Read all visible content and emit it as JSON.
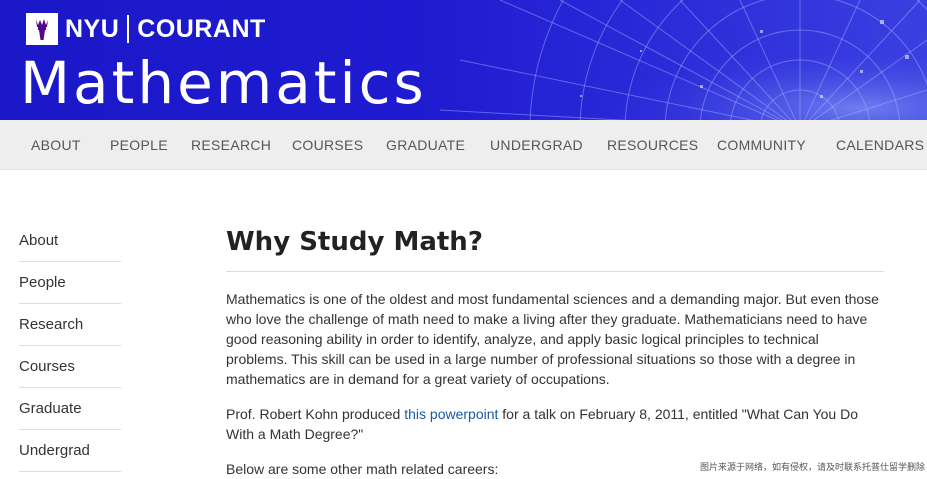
{
  "header": {
    "brand_nyu": "NYU",
    "brand_courant": "COURANT",
    "title": "Mathematics",
    "bg_color": "#1f1bd0"
  },
  "nav": {
    "items": [
      "ABOUT",
      "PEOPLE",
      "RESEARCH",
      "COURSES",
      "GRADUATE",
      "UNDERGRAD",
      "RESOURCES",
      "COMMUNITY",
      "CALENDARS"
    ]
  },
  "sidebar": {
    "items": [
      "About",
      "People",
      "Research",
      "Courses",
      "Graduate",
      "Undergrad"
    ]
  },
  "main": {
    "title": "Why Study Math?",
    "para1": "Mathematics is one of the oldest and most fundamental sciences and a demanding major. But even those who love the challenge of math need to make a living after they graduate. Mathematicians need to have good reasoning ability in order to identify, analyze, and apply basic logical principles to technical problems. This skill can be used in a large number of professional situations so those with a degree in mathematics are in demand for a great variety of occupations.",
    "para2_before": "Prof. Robert Kohn produced ",
    "para2_link": "this powerpoint",
    "para2_after": " for a talk on February 8, 2011, entitled \"What Can You Do With a Math Degree?\"",
    "para3": "Below are some other math related careers:"
  },
  "watermark": "图片来源于网络，如有侵权，请及时联系托普仕留学删除",
  "colors": {
    "nav_bg": "#eeeeee",
    "link": "#1a5aa8"
  }
}
